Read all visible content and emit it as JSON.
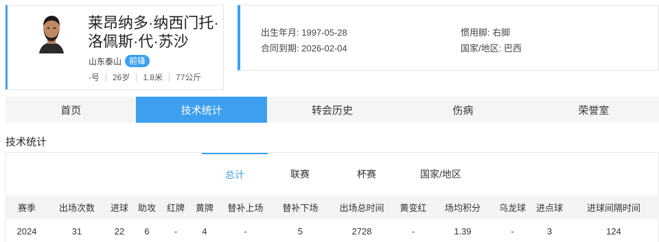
{
  "player": {
    "name_line1": "莱昂纳多·纳西门托·",
    "name_line2": "洛佩斯·代·苏沙",
    "club": "山东泰山",
    "position": "前锋",
    "number": "-号",
    "age": "26岁",
    "height": "1.8米",
    "weight": "77公斤"
  },
  "info": {
    "birth_label": "出生年月: ",
    "birth_value": "1997-05-28",
    "contract_label": "合同到期: ",
    "contract_value": "2026-02-04",
    "foot_label": "惯用脚: ",
    "foot_value": "右脚",
    "country_label": "国家/地区: ",
    "country_value": "巴西"
  },
  "tabs": [
    "首页",
    "技术统计",
    "转会历史",
    "伤病",
    "荣誉室"
  ],
  "active_tab": "技术统计",
  "section_title": "技术统计",
  "sub_tabs": [
    "总计",
    "联赛",
    "杯赛",
    "国家/地区"
  ],
  "active_sub_tab": "总计",
  "table": {
    "headers": [
      "赛季",
      "出场次数",
      "进球",
      "助攻",
      "红牌",
      "黄牌",
      "替补上场",
      "替补下场",
      "出场总时间",
      "黄变红",
      "场均积分",
      "乌龙球",
      "进点球",
      "进球间隔时间"
    ],
    "rows": [
      [
        "2024",
        "31",
        "22",
        "6",
        "-",
        "4",
        "-",
        "5",
        "2728",
        "-",
        "1.39",
        "-",
        "3",
        "124"
      ]
    ]
  },
  "colors": {
    "accent": "#3d9ff0",
    "tab_bg": "#f5f5f5",
    "header_bg": "#f4f4f4"
  }
}
